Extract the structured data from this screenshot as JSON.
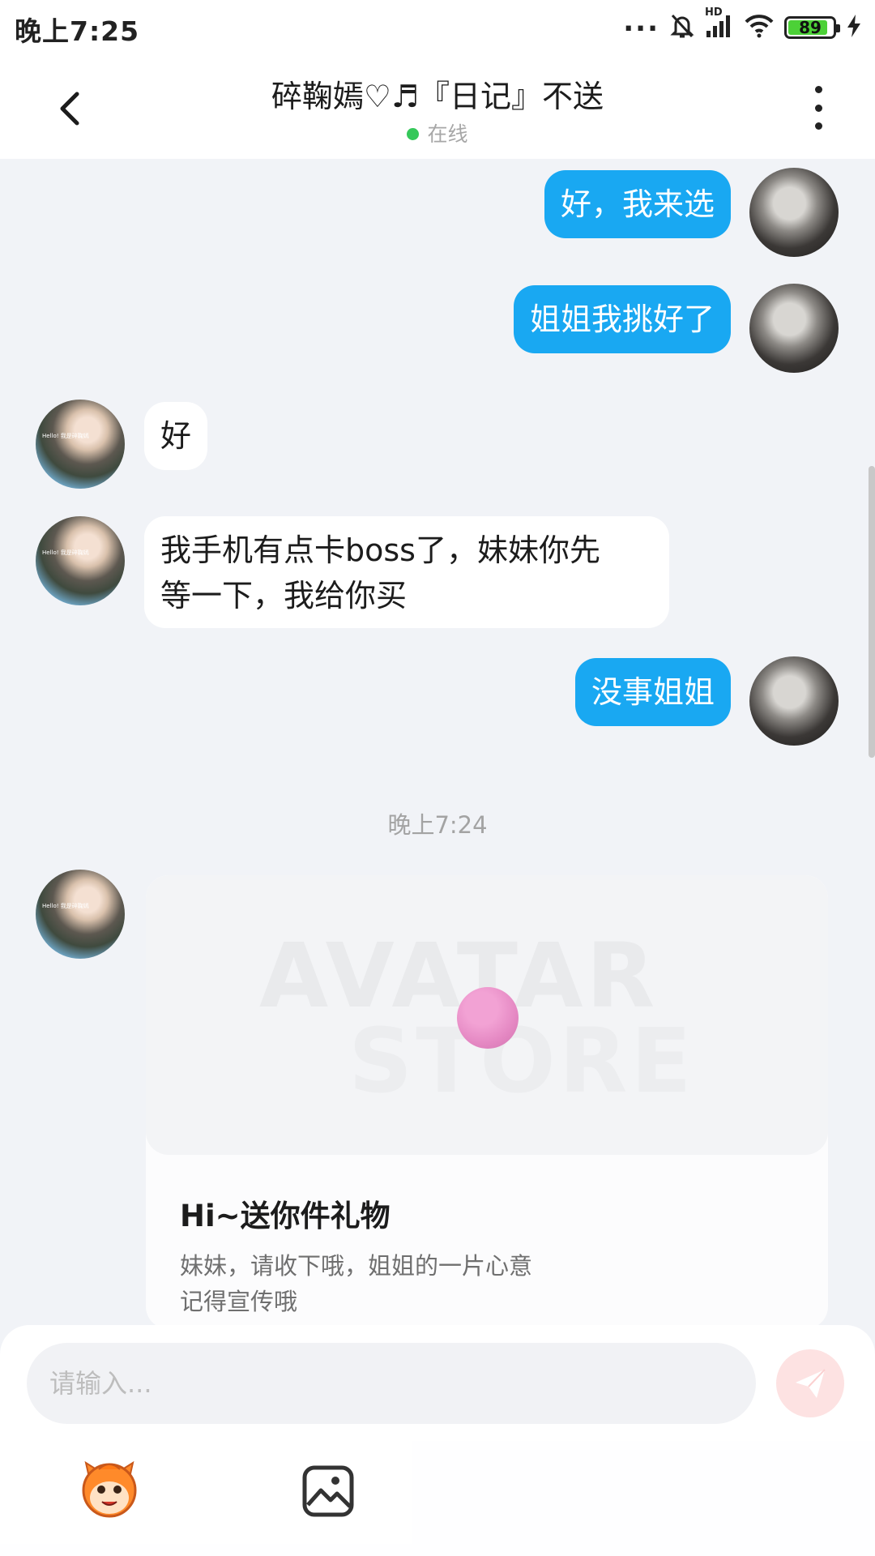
{
  "status_bar": {
    "time": "晚上7:25",
    "dots": "...",
    "network": "HD",
    "battery": 89,
    "battery_label": "89"
  },
  "header": {
    "title": "碎鞠嫣♡♬『日记』不送",
    "status": "在线"
  },
  "messages": [
    {
      "side": "right",
      "text": "好，我来选"
    },
    {
      "side": "right",
      "text": "姐姐我挑好了"
    },
    {
      "side": "left",
      "text": "好"
    },
    {
      "side": "left",
      "lines": [
        "我手机有点卡boss了，妹妹你先",
        "等一下，我给你买"
      ]
    },
    {
      "side": "right",
      "text": "没事姐姐"
    }
  ],
  "timestamp": "晚上7:24",
  "gift_card": {
    "watermark_line1": "AVATAR",
    "watermark_line2": "STORE",
    "title": "Hi~送你件礼物",
    "desc_lines": [
      "妹妹，请收下哦，姐姐的一片心意",
      "记得宣传哦"
    ]
  },
  "other_avatar_text": "Hello! 我是碎鞠嫣",
  "input": {
    "placeholder": "请输入..."
  },
  "colors": {
    "outgoing_bubble": "#19a8f2",
    "incoming_bubble": "#ffffff",
    "online_dot": "#35c85a",
    "send_button": "#fde2e2",
    "battery_fill": "#4cd137"
  },
  "icons": [
    "back-arrow-icon",
    "more-vertical-icon",
    "mute-bell-icon",
    "signal-icon",
    "wifi-icon",
    "battery-icon",
    "charging-icon",
    "send-icon",
    "emoji-icon",
    "image-icon"
  ]
}
